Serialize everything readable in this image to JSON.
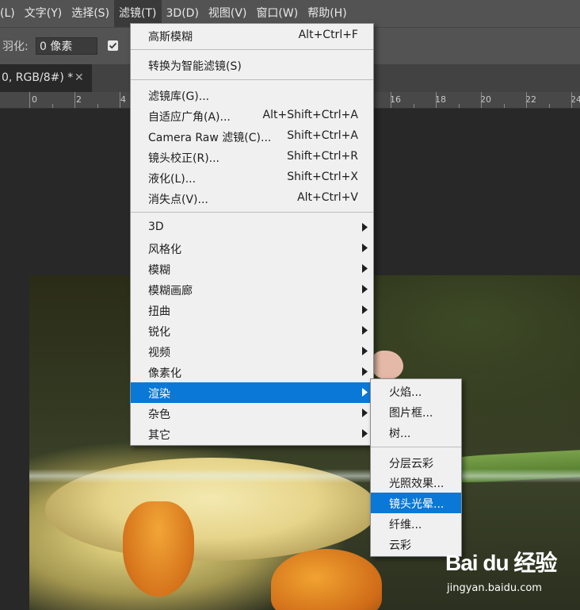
{
  "menubar": {
    "items": [
      "(L)",
      "文字(Y)",
      "选择(S)",
      "滤镜(T)",
      "3D(D)",
      "视图(V)",
      "窗口(W)",
      "帮助(H)"
    ]
  },
  "options": {
    "feather_label": "羽化:",
    "feather_value": "0 像素"
  },
  "document_tab": {
    "title": "0, RGB/8#) *",
    "close": "✕"
  },
  "ruler": {
    "labels": [
      "0",
      "2",
      "4",
      "16",
      "18",
      "20",
      "22",
      "24"
    ]
  },
  "filter_menu": {
    "items": [
      {
        "label": "高斯模糊",
        "shortcut": "Alt+Ctrl+F"
      },
      {
        "label": "转换为智能滤镜(S)",
        "shortcut": ""
      },
      {
        "label": "滤镜库(G)...",
        "shortcut": ""
      },
      {
        "label": "自适应广角(A)...",
        "shortcut": "Alt+Shift+Ctrl+A"
      },
      {
        "label": "Camera Raw 滤镜(C)...",
        "shortcut": "Shift+Ctrl+A"
      },
      {
        "label": "镜头校正(R)...",
        "shortcut": "Shift+Ctrl+R"
      },
      {
        "label": "液化(L)...",
        "shortcut": "Shift+Ctrl+X"
      },
      {
        "label": "消失点(V)...",
        "shortcut": "Alt+Ctrl+V"
      },
      {
        "label": "3D",
        "submenu": true
      },
      {
        "label": "风格化",
        "submenu": true
      },
      {
        "label": "模糊",
        "submenu": true
      },
      {
        "label": "模糊画廊",
        "submenu": true
      },
      {
        "label": "扭曲",
        "submenu": true
      },
      {
        "label": "锐化",
        "submenu": true
      },
      {
        "label": "视频",
        "submenu": true
      },
      {
        "label": "像素化",
        "submenu": true
      },
      {
        "label": "渲染",
        "submenu": true,
        "highlighted": true
      },
      {
        "label": "杂色",
        "submenu": true
      },
      {
        "label": "其它",
        "submenu": true
      }
    ]
  },
  "render_submenu": {
    "items": [
      {
        "label": "火焰..."
      },
      {
        "label": "图片框..."
      },
      {
        "label": "树..."
      },
      {
        "label": "分层云彩"
      },
      {
        "label": "光照效果..."
      },
      {
        "label": "镜头光晕...",
        "highlighted": true
      },
      {
        "label": "纤维..."
      },
      {
        "label": "云彩"
      }
    ]
  },
  "watermark": {
    "logo": "Bai du 经验",
    "url": "jingyan.baidu.com"
  },
  "colors": {
    "highlight": "#0a78d6",
    "menu_bg": "#f0f0f0",
    "chrome": "#535353"
  }
}
